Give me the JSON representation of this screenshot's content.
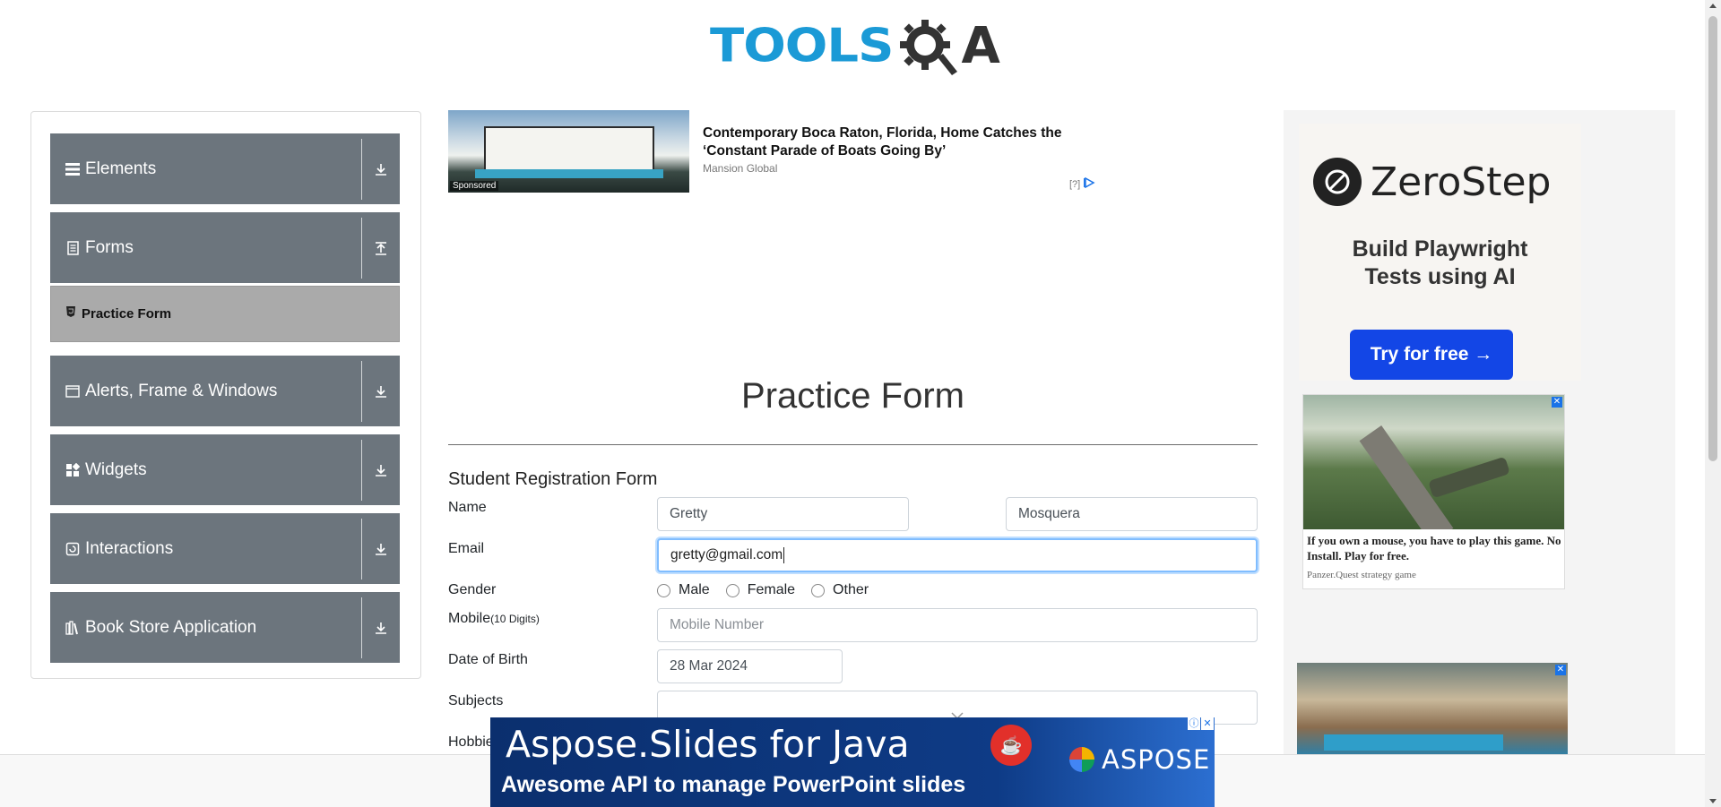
{
  "logo": {
    "text_blue": "TOOLS",
    "text_dark": "A"
  },
  "sidebar": {
    "groups": [
      {
        "label": "Elements",
        "icon": "hamburger-icon",
        "arrow": "download-icon"
      },
      {
        "label": "Forms",
        "icon": "document-icon",
        "arrow": "upload-icon"
      },
      {
        "label": "Alerts, Frame & Windows",
        "icon": "window-icon",
        "arrow": "download-icon"
      },
      {
        "label": "Widgets",
        "icon": "grid-icon",
        "arrow": "download-icon"
      },
      {
        "label": "Interactions",
        "icon": "interaction-icon",
        "arrow": "download-icon"
      },
      {
        "label": "Book Store Application",
        "icon": "books-icon",
        "arrow": "download-icon"
      }
    ],
    "active_item": {
      "label": "Practice Form",
      "icon": "html5-icon"
    }
  },
  "top_ad": {
    "title": "Contemporary Boca Raton, Florida, Home Catches the ‘Constant Parade of Boats Going By’",
    "source": "Mansion Global",
    "sponsored": "Sponsored",
    "adchoice": "[?]"
  },
  "form": {
    "page_title": "Practice Form",
    "subtitle": "Student Registration Form",
    "name_label": "Name",
    "first_name": "Gretty",
    "last_name": "Mosquera",
    "email_label": "Email",
    "email": "gretty@gmail.com",
    "gender_label": "Gender",
    "gender_options": [
      "Male",
      "Female",
      "Other"
    ],
    "mobile_label": "Mobile",
    "mobile_hint": "(10 Digits)",
    "mobile_placeholder": "Mobile Number",
    "dob_label": "Date of Birth",
    "dob": "28 Mar 2024",
    "subjects_label": "Subjects",
    "hobbies_label": "Hobbie"
  },
  "right_ad": {
    "brand": "ZeroStep",
    "tagline_1": "Build Playwright",
    "tagline_2": "Tests using AI",
    "cta": "Try for free →",
    "game_text": "If you own a mouse, you have to play this game. No Install. Play for free.",
    "game_source": "Panzer.Quest strategy game"
  },
  "banner": {
    "line1": "Aspose.Slides for Java",
    "line2": "Awesome API to manage PowerPoint  slides",
    "brand": "ASPOSE"
  },
  "colors": {
    "sidebar_bg": "#6c757d",
    "active_bg": "#aaaaaa",
    "logo_blue": "#1b9ad6",
    "cta_blue": "#1346e6",
    "focus": "#80bdff"
  }
}
